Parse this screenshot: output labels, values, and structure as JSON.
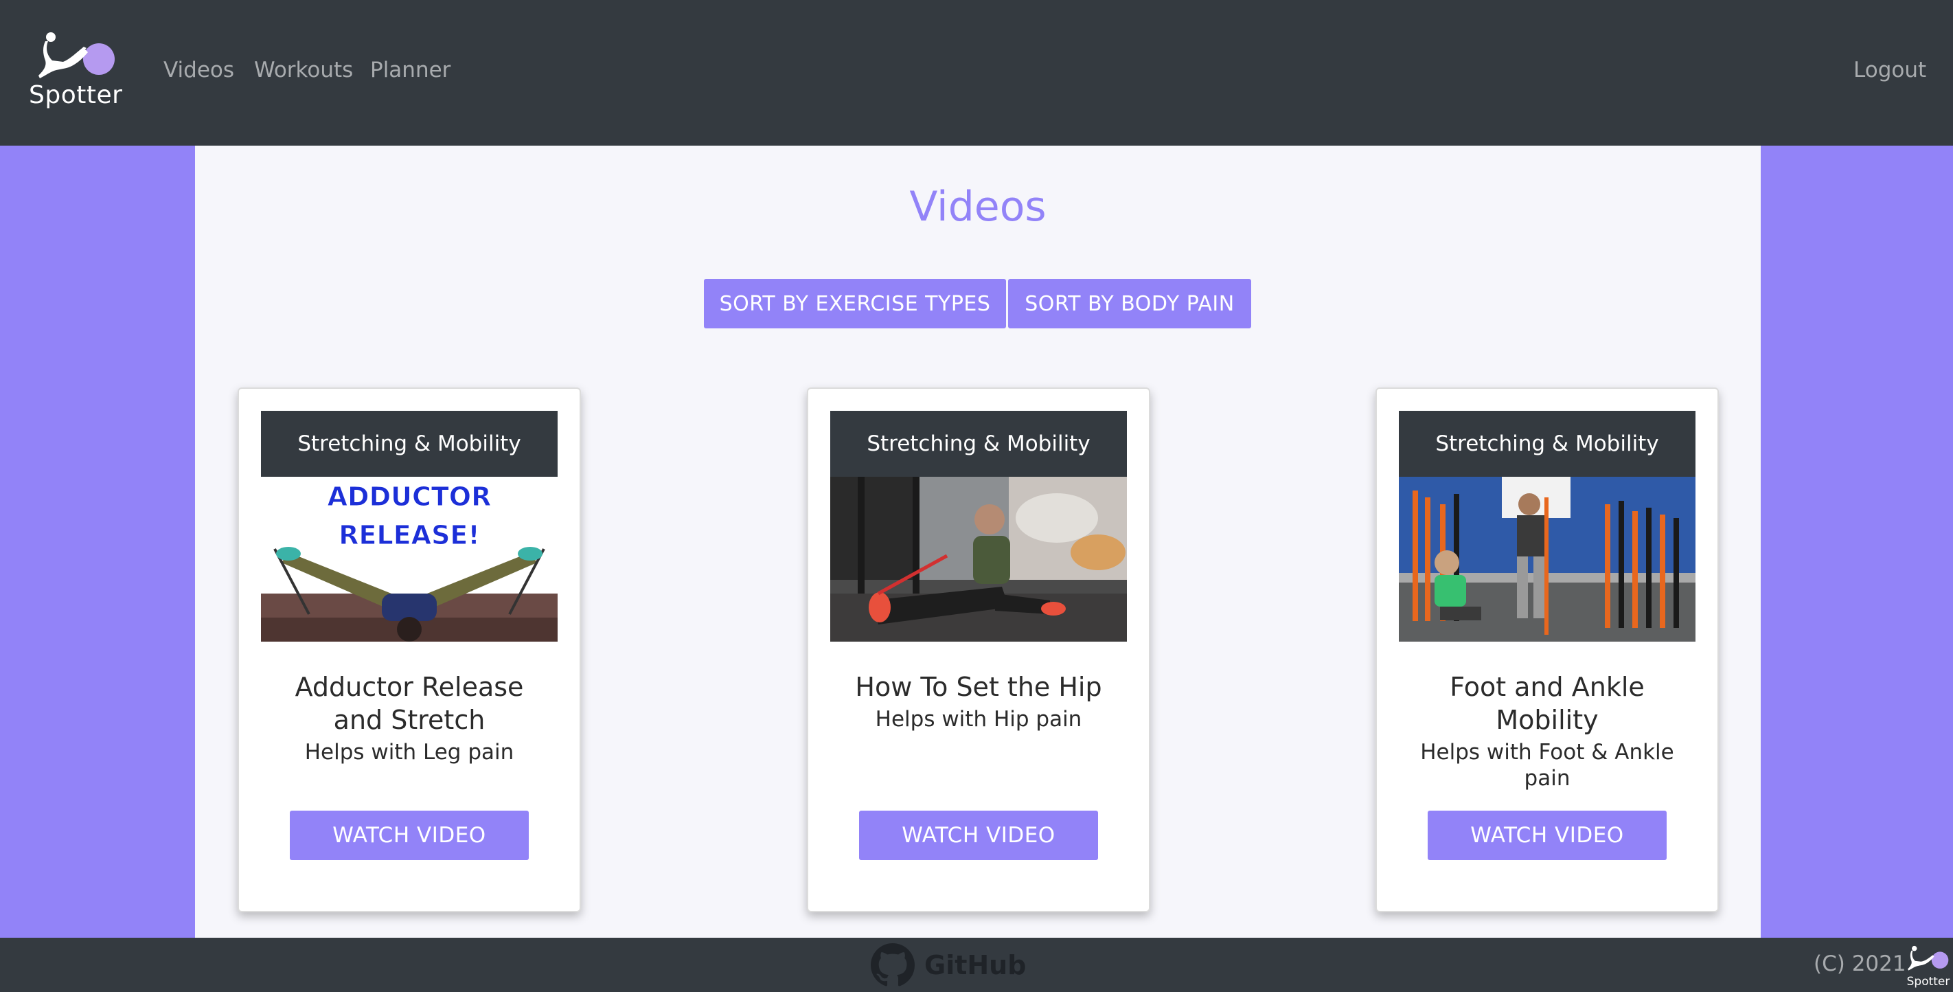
{
  "brand": {
    "name": "Spotter"
  },
  "nav": {
    "items": [
      {
        "label": "Videos"
      },
      {
        "label": "Workouts"
      },
      {
        "label": "Planner"
      }
    ],
    "logout": "Logout"
  },
  "page": {
    "title": "Videos",
    "sort_buttons": {
      "exercise_types": "SORT BY EXERCISE TYPES",
      "body_pain": "SORT BY BODY PAIN"
    }
  },
  "cards": [
    {
      "category": "Stretching & Mobility",
      "thumbnail_text": "ADDUCTOR\nRELEASE!",
      "title": "Adductor Release and Stretch",
      "subtitle": "Helps with Leg pain",
      "button": "WATCH VIDEO"
    },
    {
      "category": "Stretching & Mobility",
      "title": "How To Set the Hip",
      "subtitle": "Helps with Hip pain",
      "button": "WATCH VIDEO"
    },
    {
      "category": "Stretching & Mobility",
      "title": "Foot and Ankle Mobility",
      "subtitle": "Helps with Foot & Ankle pain",
      "button": "WATCH VIDEO"
    }
  ],
  "footer": {
    "github": "GitHub",
    "copyright": "(C) 2021",
    "logo_text": "Spotter"
  },
  "colors": {
    "accent": "#9283f8",
    "navbar": "#343a40",
    "panel": "#f6f6fb"
  }
}
